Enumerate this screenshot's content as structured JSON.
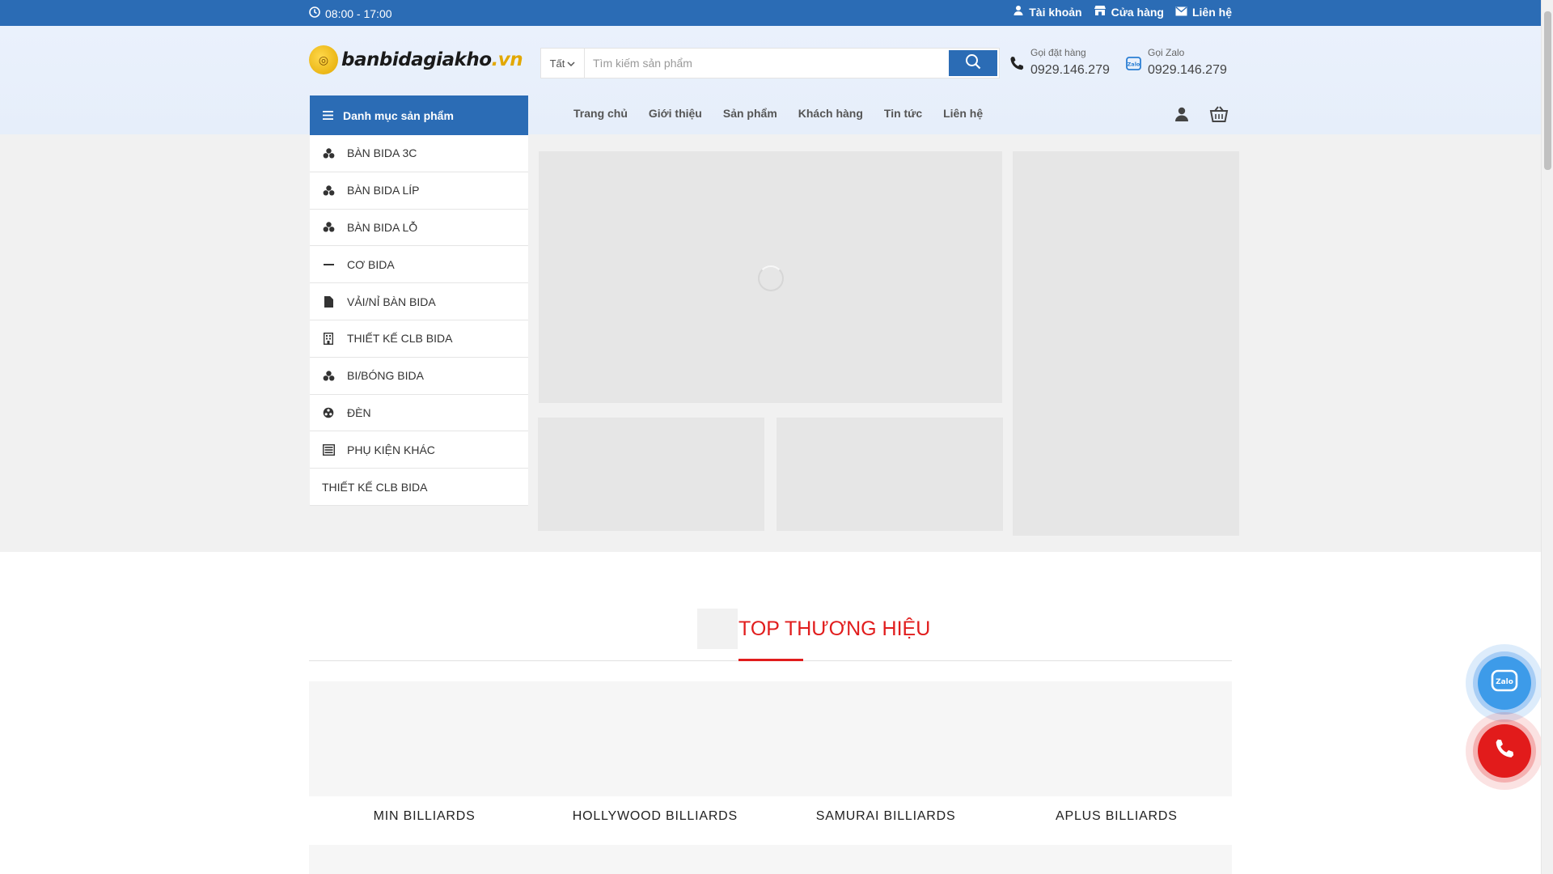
{
  "topbar": {
    "hours": "08:00 - 17:00",
    "account": "Tài khoản",
    "store": "Cửa hàng",
    "contact": "Liên hệ"
  },
  "logo": {
    "name": "banbidagiakho",
    "ext": ".vn"
  },
  "search": {
    "category": "Tất",
    "placeholder": "Tìm kiếm sản phẩm"
  },
  "contacts": [
    {
      "label": "Gọi đặt hàng",
      "number": "0929.146.279",
      "icon": "phone-icon"
    },
    {
      "label": "Gọi Zalo",
      "number": "0929.146.279",
      "icon": "zalo-icon"
    }
  ],
  "category_menu": {
    "title": "Danh mục sản phẩm",
    "items": [
      {
        "label": "BÀN BIDA 3C",
        "icon": "balls-icon"
      },
      {
        "label": "BÀN BIDA LÍP",
        "icon": "balls-icon"
      },
      {
        "label": "BÀN BIDA LỖ",
        "icon": "balls-icon"
      },
      {
        "label": "CƠ BIDA",
        "icon": "cue-icon"
      },
      {
        "label": "VẢI/NỈ BÀN BIDA",
        "icon": "document-icon"
      },
      {
        "label": "THIẾT KẾ CLB BIDA",
        "icon": "building-icon"
      },
      {
        "label": "BI/BÓNG BIDA",
        "icon": "balls-icon"
      },
      {
        "label": "ĐÈN",
        "icon": "lamp-icon"
      },
      {
        "label": "PHỤ KIỆN KHÁC",
        "icon": "list-icon"
      },
      {
        "label": "THIẾT KẾ CLB BIDA",
        "icon": ""
      }
    ]
  },
  "nav": [
    "Trang chủ",
    "Giới thiệu",
    "Sản phẩm",
    "Khách hàng",
    "Tin tức",
    "Liên hệ"
  ],
  "brands": {
    "title": "TOP THƯƠNG HIỆU",
    "names": [
      "MIN BILLIARDS",
      "HOLLYWOOD BILLIARDS",
      "SAMURAI BILLIARDS",
      "APLUS BILLIARDS"
    ]
  },
  "colors": {
    "brand_blue": "#2b6cb5",
    "accent_red": "#e11d1d",
    "logo_gold": "#e2a800"
  }
}
